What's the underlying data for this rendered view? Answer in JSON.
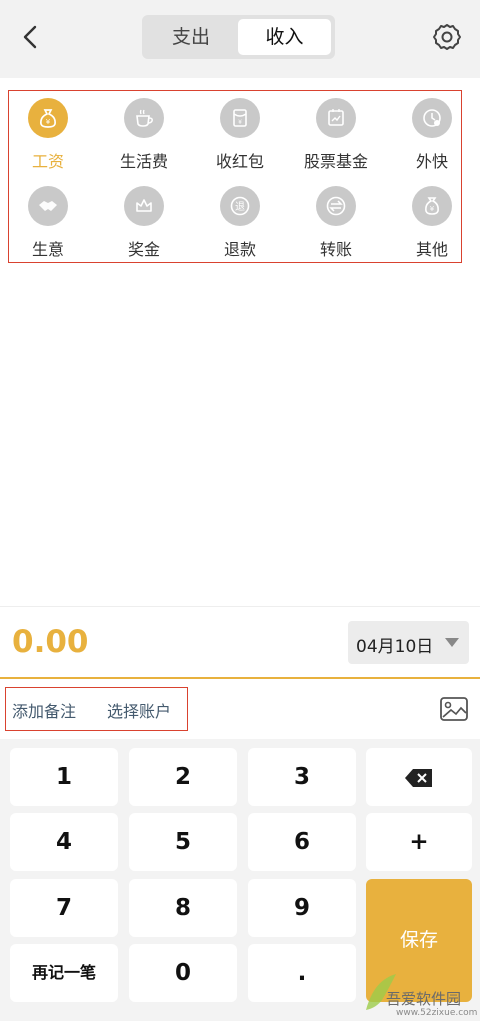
{
  "header": {
    "tabs": [
      {
        "label": "支出"
      },
      {
        "label": "收入"
      }
    ],
    "active_tab": "收入"
  },
  "categories": [
    {
      "label": "工资",
      "icon": "money-bag-icon",
      "active": true
    },
    {
      "label": "生活费",
      "icon": "coffee-cup-icon"
    },
    {
      "label": "收红包",
      "icon": "red-envelope-icon"
    },
    {
      "label": "股票基金",
      "icon": "stock-chart-icon"
    },
    {
      "label": "外快",
      "icon": "clock-coin-icon"
    },
    {
      "label": "生意",
      "icon": "handshake-icon"
    },
    {
      "label": "奖金",
      "icon": "crown-icon"
    },
    {
      "label": "退款",
      "icon": "refund-icon"
    },
    {
      "label": "转账",
      "icon": "transfer-icon"
    },
    {
      "label": "其他",
      "icon": "coin-bag-icon"
    }
  ],
  "amount": "0.00",
  "date": {
    "label": "04月10日"
  },
  "note": {
    "add_note": "添加备注",
    "select_account": "选择账户"
  },
  "keypad": {
    "k1": "1",
    "k2": "2",
    "k3": "3",
    "k4": "4",
    "k5": "5",
    "k6": "6",
    "plus": "+",
    "k7": "7",
    "k8": "8",
    "k9": "9",
    "again": "再记一笔",
    "k0": "0",
    "dot": ".",
    "save": "保存"
  },
  "watermark": {
    "text": "吾爱软件园",
    "url": "www.52zixue.com"
  },
  "colors": {
    "accent": "#e8b13e",
    "highlight_border": "#d9422f",
    "icon_gray": "#c9c9c9"
  }
}
